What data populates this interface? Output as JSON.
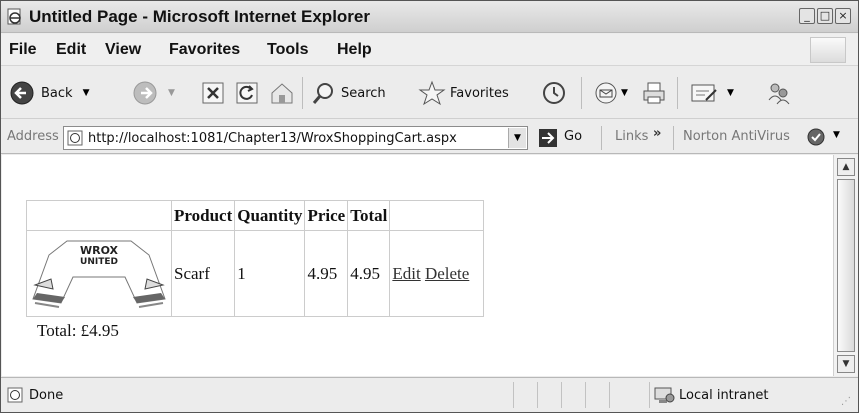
{
  "window": {
    "title": "Untitled Page - Microsoft Internet Explorer"
  },
  "menu": {
    "items": [
      "File",
      "Edit",
      "View",
      "Favorites",
      "Tools",
      "Help"
    ]
  },
  "toolbar": {
    "back_label": "Back",
    "search_label": "Search",
    "favorites_label": "Favorites"
  },
  "address": {
    "label": "Address",
    "url": "http://localhost:1081/Chapter13/WroxShoppingCart.aspx",
    "go_label": "Go",
    "links_label": "Links",
    "norton_label": "Norton AntiVirus"
  },
  "cart": {
    "headers": [
      "Product",
      "Quantity",
      "Price",
      "Total"
    ],
    "rows": [
      {
        "product": "Scarf",
        "quantity": "1",
        "price": "4.95",
        "total": "4.95",
        "edit": "Edit",
        "delete": "Delete"
      }
    ],
    "total_line": "Total: £4.95",
    "image_text": [
      "WROX",
      "UNITED"
    ]
  },
  "status": {
    "text": "Done",
    "zone": "Local intranet"
  }
}
